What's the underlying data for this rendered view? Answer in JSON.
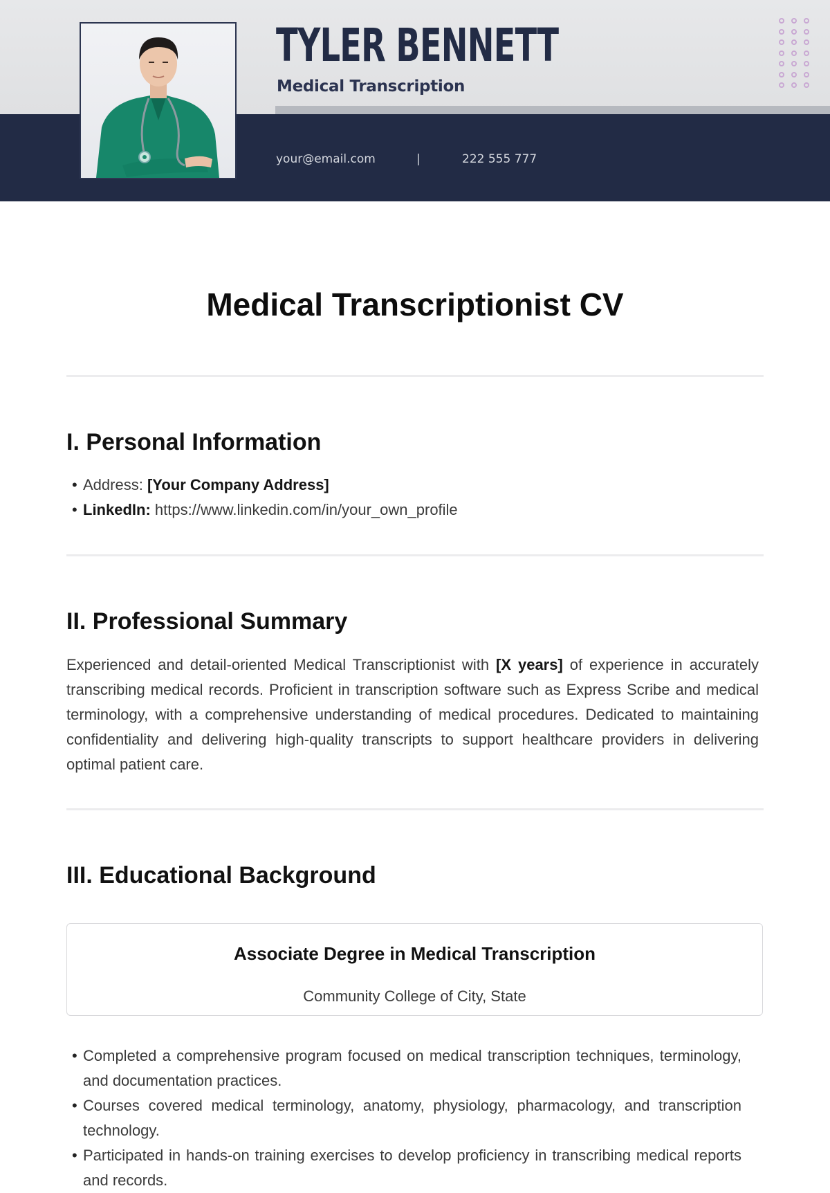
{
  "header": {
    "name": "TYLER BENNETT",
    "role": "Medical Transcription",
    "email": "your@email.com",
    "separator": "|",
    "phone": "222 555 777",
    "photo_alt": "Portrait of a man in green medical scrubs with a stethoscope",
    "colors": {
      "navy": "#222b45",
      "light_bg": "#e4e5e7",
      "dot_accent": "#c9a8d3"
    }
  },
  "document": {
    "title": "Medical Transcriptionist CV"
  },
  "sections": {
    "personal": {
      "heading": "I. Personal Information",
      "items": [
        {
          "label": "Address:",
          "value": "[Your Company Address]"
        },
        {
          "label": "LinkedIn:",
          "value": "https://www.linkedin.com/in/your_own_profile"
        }
      ]
    },
    "summary": {
      "heading": "II. Professional Summary",
      "text_before": "Experienced and detail-oriented Medical Transcriptionist with ",
      "highlight": "[X years]",
      "text_after": " of experience in accurately transcribing medical records. Proficient in transcription software such as Express Scribe and medical terminology, with a comprehensive understanding of medical procedures. Dedicated to maintaining confidentiality and delivering high-quality transcripts to support healthcare providers in delivering optimal patient care."
    },
    "education": {
      "heading": "III. Educational Background",
      "degree": "Associate Degree in Medical Transcription",
      "school": "Community College of City, State",
      "bullets": [
        "Completed a comprehensive program focused on medical transcription techniques, terminology, and documentation practices.",
        "Courses covered medical terminology, anatomy, physiology, pharmacology, and transcription technology.",
        "Participated in hands-on training exercises to develop proficiency in transcribing medical reports and records."
      ]
    }
  }
}
